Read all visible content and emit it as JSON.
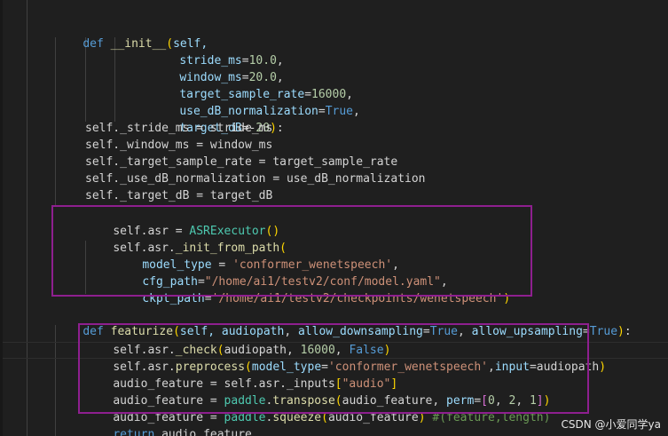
{
  "theme": {
    "background": "#1f1f1f",
    "keyword": "#569cd6",
    "function": "#dcdcaa",
    "parameter": "#9cdcfe",
    "number": "#b5cea8",
    "string": "#ce9178",
    "class": "#4ec9b0",
    "comment": "#6a9955",
    "bracket_level1": "#ffd700",
    "bracket_level2": "#da70d6",
    "bracket_level3": "#179fff",
    "highlight_box": "#8e1f8f"
  },
  "code": {
    "l1": {
      "kw": "def",
      "sp": " ",
      "fn": "__init__",
      "br": "(",
      "self": "self,"
    },
    "l2": {
      "name": "stride_ms",
      "eq": "=",
      "val": "10.0",
      "end": ","
    },
    "l3": {
      "name": "window_ms",
      "eq": "=",
      "val": "20.0",
      "end": ","
    },
    "l4": {
      "name": "target_sample_rate",
      "eq": "=",
      "val": "16000",
      "end": ","
    },
    "l5": {
      "name": "use_dB_normalization",
      "eq": "=",
      "val": "True",
      "end": ","
    },
    "l6": {
      "name": "target_dB",
      "eq": "=-",
      "val": "20",
      "br": ")",
      "end": ":"
    },
    "l7": "self._stride_ms = stride_ms",
    "l8": "self._window_ms = window_ms",
    "l9": "self._target_sample_rate = target_sample_rate",
    "l10": "self._use_dB_normalization = use_dB_normalization",
    "l11": "self._target_dB = target_dB",
    "l12": {
      "pre": "self.asr = ",
      "cls": "ASRExecutor",
      "br": "()"
    },
    "l13": {
      "pre": "self.asr.",
      "fn": "_init_from_path",
      "br": "("
    },
    "l14": {
      "name": "model_type",
      "eq": " = ",
      "val": "'conformer_wenetspeech'",
      "end": ","
    },
    "l15": {
      "name": "cfg_path",
      "eq": "=",
      "val": "\"/home/ai1/testv2/conf/model.yaml\"",
      "end": ","
    },
    "l16": {
      "name": "ckpt_path",
      "eq": "=",
      "val": "'/home/ai1/testv2/checkpoints/wenetspeech'",
      "br": ")"
    },
    "l17": {
      "kw": "def",
      "fn": "featurize",
      "br": "(",
      "self": "self, ",
      "p1": "audiopath",
      "sep1": ", ",
      "p2": "allow_downsampling",
      "eq1": "=",
      "v1": "True",
      "sep2": ", ",
      "p3": "allow_upsampling",
      "eq2": "=",
      "v2": "True",
      "brc": ")",
      "end": ":"
    },
    "l18": {
      "pre": "self.asr.",
      "fn": "_check",
      "br": "(",
      "a1": "audiopath, ",
      "n": "16000",
      "sep": ", ",
      "b": "False",
      "brc": ")"
    },
    "l19": {
      "pre": "self.asr.",
      "fn": "preprocess",
      "br": "(",
      "p": "model_type",
      "eq": "=",
      "s": "'conformer_wenetspeech'",
      "sep": ",",
      "p2": "input",
      "eq2": "=",
      "a": "audiopath",
      "brc": ")"
    },
    "l20": {
      "pre": "audio_feature = self.asr._inputs",
      "br": "[",
      "s": "\"audio\"",
      "brc": "]"
    },
    "l21": {
      "pre": "audio_feature = ",
      "mod": "paddle",
      "dot": ".",
      "fn": "transpose",
      "br": "(",
      "a": "audio_feature, ",
      "p": "perm",
      "eq": "=",
      "br2": "[",
      "n1": "0",
      "c1": ", ",
      "n2": "2",
      "c2": ", ",
      "n3": "1",
      "br2c": "]",
      "brc": ")"
    },
    "l22": {
      "pre": "audio_feature = ",
      "mod": "paddle",
      "dot": ".",
      "fn": "squeeze",
      "br": "(",
      "a": "audio_feature",
      "brc": ")",
      "cmt": " #(feature,length)"
    },
    "l23": {
      "kw": "return",
      "rest": " audio_feature"
    }
  },
  "watermark": "CSDN @小爱同学ya"
}
